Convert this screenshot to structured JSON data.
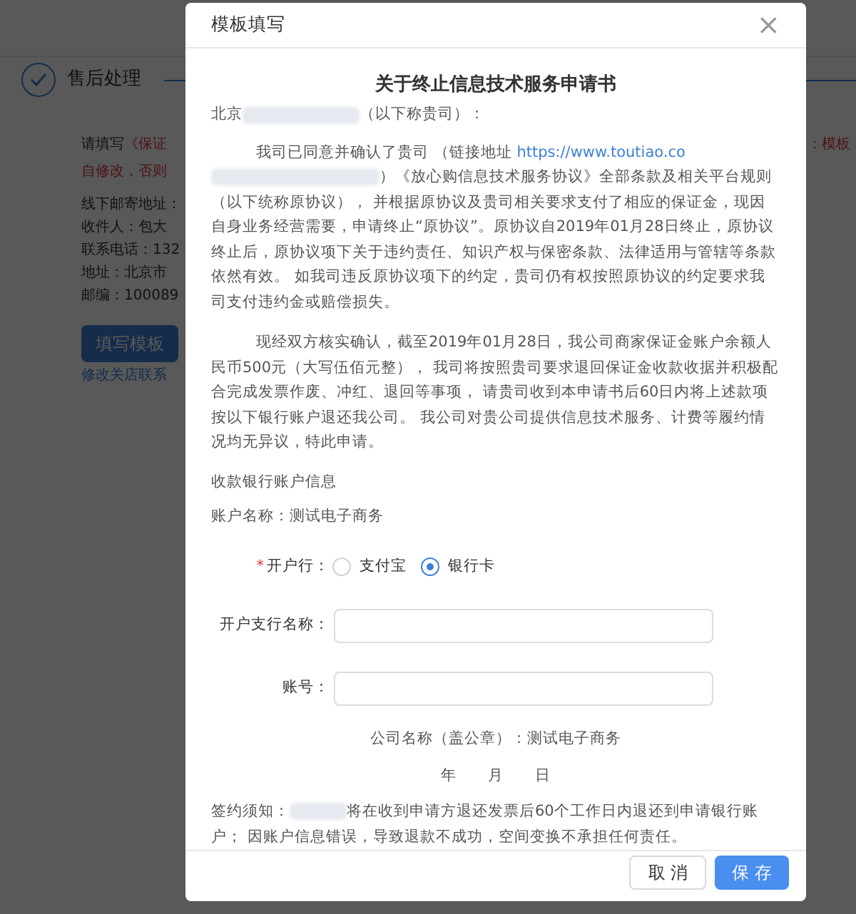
{
  "background": {
    "step_label": "售后处理",
    "notice_prefix": "请填写",
    "notice_red": "《保证",
    "notice_red_line2": "自修改，否则",
    "notice_right": "：模板",
    "address_lines": [
      "线下邮寄地址：",
      "收件人：包大",
      "联系电话：132",
      "地址：北京市",
      "邮编：100089"
    ],
    "fill_button": "填写模板",
    "link": "修改关店联系"
  },
  "modal": {
    "title": "模板填写",
    "close": "×",
    "doc_title": "关于终止信息技术服务申请书",
    "salutation": {
      "prefix": "北京",
      "suffix": "（以下称贵司）："
    },
    "paragraph_1": {
      "before_link": "我司已同意并确认了贵司 （链接地址",
      "link": "https://www.toutiao.co",
      "after_link": "）《放心购信息技术服务协议》全部条款及相关平台规则（以下统称原协议）， 并根据原协议及贵司相关要求支付了相应的保证金，现因自身业务经营需要，申请终止“原协议”。原协议自2019年01月28日终止，原协议终止后，原协议项下关于违约责任、知识产权与保密条款、法律适用与管辖等条款依然有效。 如我司违反原协议项下的约定，贵司仍有权按照原协议的约定要求我司支付违约金或赔偿损失。"
    },
    "paragraph_2": "现经双方核实确认，截至2019年01月28日，我公司商家保证金账户余额人民币500元（大写伍佰元整）， 我司将按照贵司要求退回保证金收款收据并积极配合完成发票作废、冲红、退回等事项， 请贵司收到本申请书后60日内将上述款项按以下银行账户退还我公司。 我公司对贵公司提供信息技术服务、计费等履约情况均无异议，特此申请。",
    "bank_info_heading": "收款银行账户信息",
    "account_name": "账户名称：测试电子商务",
    "form": {
      "bank_label": "开户行：",
      "required": true,
      "required_mark": "*",
      "options": [
        {
          "label": "支付宝",
          "selected": false
        },
        {
          "label": "银行卡",
          "selected": true
        }
      ],
      "branch_label": "开户支行名称：",
      "account_label": "账号："
    },
    "company_name": "公司名称（盖公章）：测试电子商务",
    "date": [
      "年",
      "月",
      "日"
    ],
    "note": {
      "prefix": "签约须知：",
      "suffix": "将在收到申请方退还发票后60个工作日内退还到申请银行账户； 因账户信息错误，导致退款不成功，空间变换不承担任何责任。"
    },
    "buttons": [
      {
        "label": "取 消",
        "kind": "default"
      },
      {
        "label": "保 存",
        "kind": "primary"
      }
    ]
  }
}
